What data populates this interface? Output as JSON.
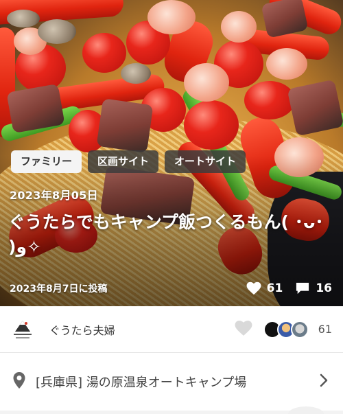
{
  "tags": [
    {
      "label": "ファミリー"
    },
    {
      "label": "区画サイト"
    },
    {
      "label": "オートサイト"
    }
  ],
  "post": {
    "date": "2023年8月05日",
    "title": "ぐうたらでもキャンプ飯つくるもん( ･ᴗ･ )ﻭ✧",
    "posted_on": "2023年8月7日に投稿",
    "likes": "61",
    "comments": "16"
  },
  "author": {
    "name": "ぐうたら夫婦",
    "like_count": "61",
    "heart_color": "#d9d9d9"
  },
  "location": {
    "text": "[兵庫県] 湯の原温泉オートキャンプ場"
  },
  "icons": {
    "stat_like": "heart-icon",
    "stat_comment": "comment-icon",
    "location": "map-pin-icon",
    "more": "chevron-right-icon"
  }
}
